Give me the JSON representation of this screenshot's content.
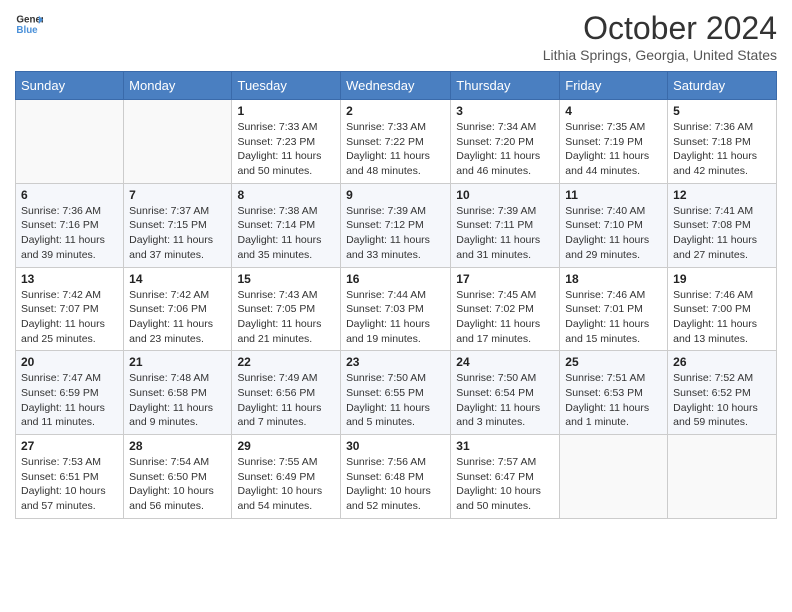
{
  "header": {
    "logo_line1": "General",
    "logo_line2": "Blue",
    "month_title": "October 2024",
    "location": "Lithia Springs, Georgia, United States"
  },
  "days_of_week": [
    "Sunday",
    "Monday",
    "Tuesday",
    "Wednesday",
    "Thursday",
    "Friday",
    "Saturday"
  ],
  "weeks": [
    [
      {
        "day": "",
        "info": ""
      },
      {
        "day": "",
        "info": ""
      },
      {
        "day": "1",
        "info": "Sunrise: 7:33 AM\nSunset: 7:23 PM\nDaylight: 11 hours and 50 minutes."
      },
      {
        "day": "2",
        "info": "Sunrise: 7:33 AM\nSunset: 7:22 PM\nDaylight: 11 hours and 48 minutes."
      },
      {
        "day": "3",
        "info": "Sunrise: 7:34 AM\nSunset: 7:20 PM\nDaylight: 11 hours and 46 minutes."
      },
      {
        "day": "4",
        "info": "Sunrise: 7:35 AM\nSunset: 7:19 PM\nDaylight: 11 hours and 44 minutes."
      },
      {
        "day": "5",
        "info": "Sunrise: 7:36 AM\nSunset: 7:18 PM\nDaylight: 11 hours and 42 minutes."
      }
    ],
    [
      {
        "day": "6",
        "info": "Sunrise: 7:36 AM\nSunset: 7:16 PM\nDaylight: 11 hours and 39 minutes."
      },
      {
        "day": "7",
        "info": "Sunrise: 7:37 AM\nSunset: 7:15 PM\nDaylight: 11 hours and 37 minutes."
      },
      {
        "day": "8",
        "info": "Sunrise: 7:38 AM\nSunset: 7:14 PM\nDaylight: 11 hours and 35 minutes."
      },
      {
        "day": "9",
        "info": "Sunrise: 7:39 AM\nSunset: 7:12 PM\nDaylight: 11 hours and 33 minutes."
      },
      {
        "day": "10",
        "info": "Sunrise: 7:39 AM\nSunset: 7:11 PM\nDaylight: 11 hours and 31 minutes."
      },
      {
        "day": "11",
        "info": "Sunrise: 7:40 AM\nSunset: 7:10 PM\nDaylight: 11 hours and 29 minutes."
      },
      {
        "day": "12",
        "info": "Sunrise: 7:41 AM\nSunset: 7:08 PM\nDaylight: 11 hours and 27 minutes."
      }
    ],
    [
      {
        "day": "13",
        "info": "Sunrise: 7:42 AM\nSunset: 7:07 PM\nDaylight: 11 hours and 25 minutes."
      },
      {
        "day": "14",
        "info": "Sunrise: 7:42 AM\nSunset: 7:06 PM\nDaylight: 11 hours and 23 minutes."
      },
      {
        "day": "15",
        "info": "Sunrise: 7:43 AM\nSunset: 7:05 PM\nDaylight: 11 hours and 21 minutes."
      },
      {
        "day": "16",
        "info": "Sunrise: 7:44 AM\nSunset: 7:03 PM\nDaylight: 11 hours and 19 minutes."
      },
      {
        "day": "17",
        "info": "Sunrise: 7:45 AM\nSunset: 7:02 PM\nDaylight: 11 hours and 17 minutes."
      },
      {
        "day": "18",
        "info": "Sunrise: 7:46 AM\nSunset: 7:01 PM\nDaylight: 11 hours and 15 minutes."
      },
      {
        "day": "19",
        "info": "Sunrise: 7:46 AM\nSunset: 7:00 PM\nDaylight: 11 hours and 13 minutes."
      }
    ],
    [
      {
        "day": "20",
        "info": "Sunrise: 7:47 AM\nSunset: 6:59 PM\nDaylight: 11 hours and 11 minutes."
      },
      {
        "day": "21",
        "info": "Sunrise: 7:48 AM\nSunset: 6:58 PM\nDaylight: 11 hours and 9 minutes."
      },
      {
        "day": "22",
        "info": "Sunrise: 7:49 AM\nSunset: 6:56 PM\nDaylight: 11 hours and 7 minutes."
      },
      {
        "day": "23",
        "info": "Sunrise: 7:50 AM\nSunset: 6:55 PM\nDaylight: 11 hours and 5 minutes."
      },
      {
        "day": "24",
        "info": "Sunrise: 7:50 AM\nSunset: 6:54 PM\nDaylight: 11 hours and 3 minutes."
      },
      {
        "day": "25",
        "info": "Sunrise: 7:51 AM\nSunset: 6:53 PM\nDaylight: 11 hours and 1 minute."
      },
      {
        "day": "26",
        "info": "Sunrise: 7:52 AM\nSunset: 6:52 PM\nDaylight: 10 hours and 59 minutes."
      }
    ],
    [
      {
        "day": "27",
        "info": "Sunrise: 7:53 AM\nSunset: 6:51 PM\nDaylight: 10 hours and 57 minutes."
      },
      {
        "day": "28",
        "info": "Sunrise: 7:54 AM\nSunset: 6:50 PM\nDaylight: 10 hours and 56 minutes."
      },
      {
        "day": "29",
        "info": "Sunrise: 7:55 AM\nSunset: 6:49 PM\nDaylight: 10 hours and 54 minutes."
      },
      {
        "day": "30",
        "info": "Sunrise: 7:56 AM\nSunset: 6:48 PM\nDaylight: 10 hours and 52 minutes."
      },
      {
        "day": "31",
        "info": "Sunrise: 7:57 AM\nSunset: 6:47 PM\nDaylight: 10 hours and 50 minutes."
      },
      {
        "day": "",
        "info": ""
      },
      {
        "day": "",
        "info": ""
      }
    ]
  ]
}
